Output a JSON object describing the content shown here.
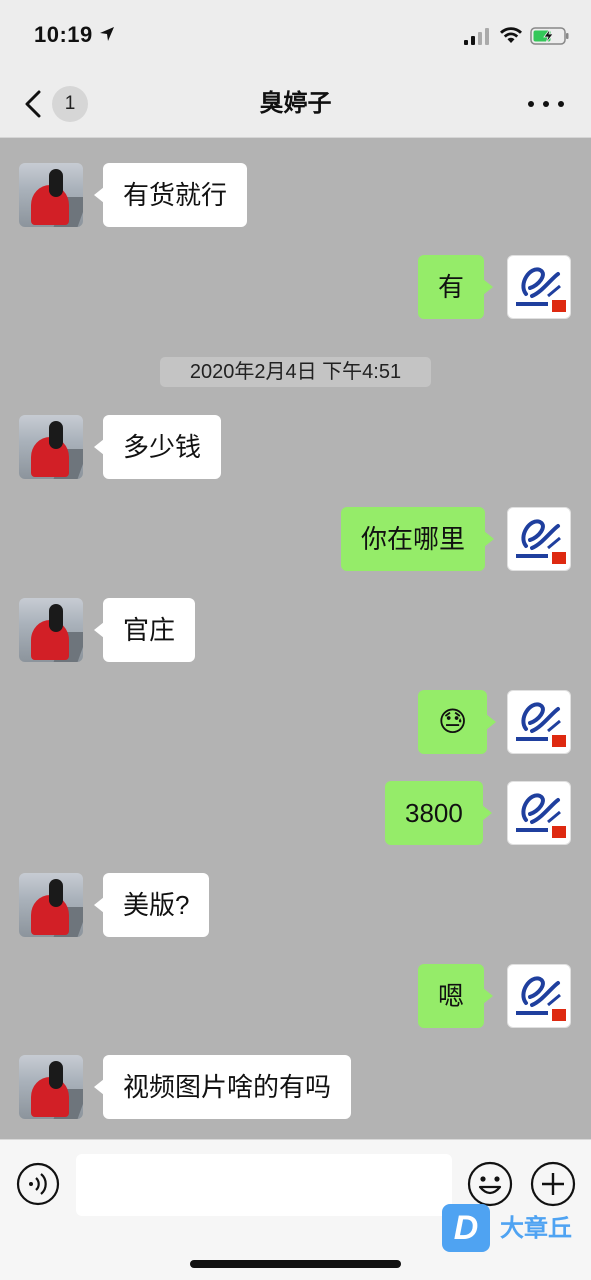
{
  "status_bar": {
    "time": "10:19"
  },
  "nav": {
    "unread_count": "1",
    "title": "臭婷子"
  },
  "messages": [
    {
      "from": "contact",
      "text": "有货就行"
    },
    {
      "from": "me",
      "text": "有"
    },
    {
      "from": "contact",
      "text": "多少钱"
    },
    {
      "from": "me",
      "text": "你在哪里"
    },
    {
      "from": "contact",
      "text": "官庄"
    },
    {
      "from": "me",
      "emoji": "😓"
    },
    {
      "from": "me",
      "text": "3800"
    },
    {
      "from": "contact",
      "text": "美版?"
    },
    {
      "from": "me",
      "text": "嗯"
    },
    {
      "from": "contact",
      "text": "视频图片啥的有吗"
    }
  ],
  "timestamp": "2020年2月4日 下午4:51",
  "input": {
    "value": "",
    "placeholder": ""
  },
  "watermark": {
    "text": "大章丘",
    "logo": "D"
  },
  "colors": {
    "outgoing_bubble": "#95ec69",
    "incoming_bubble": "#ffffff",
    "chat_background": "#b3b3b3"
  }
}
